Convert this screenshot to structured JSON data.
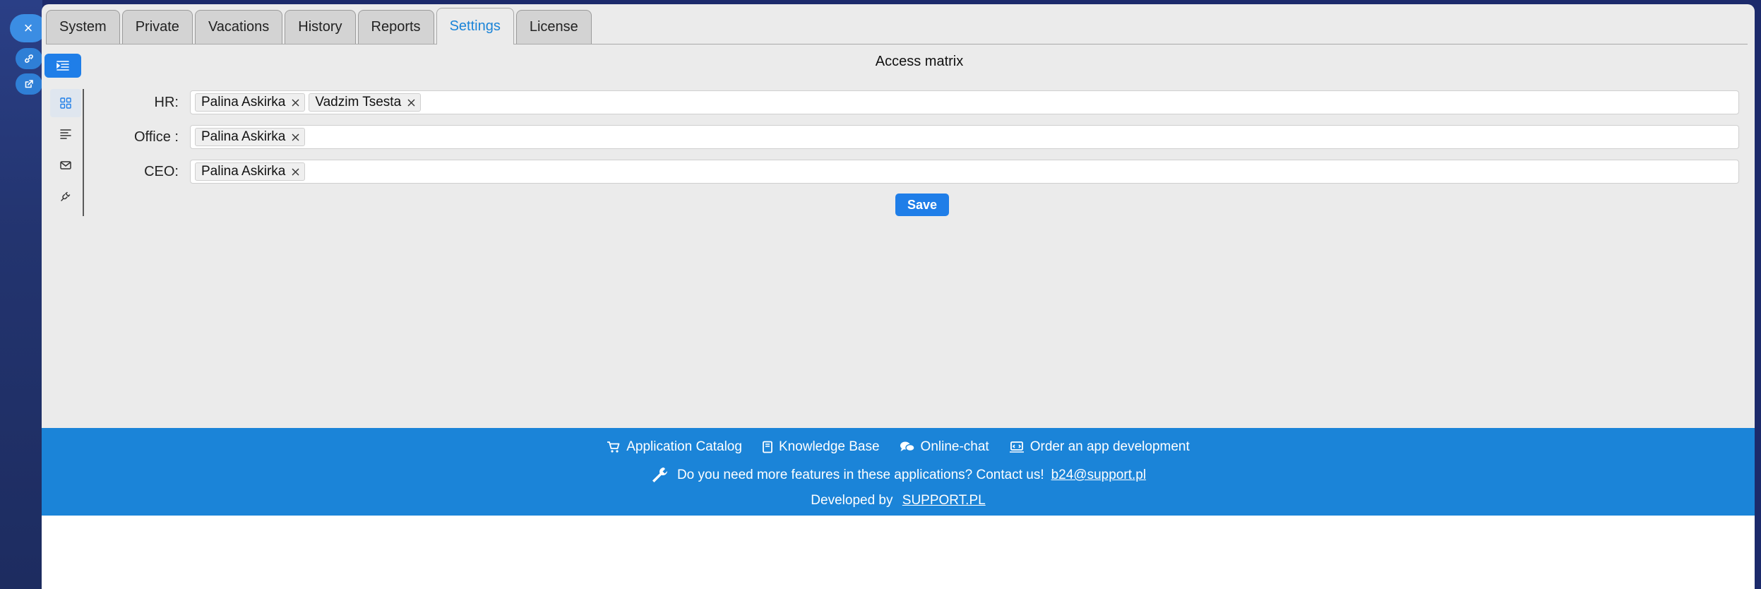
{
  "tabs": [
    {
      "label": "System"
    },
    {
      "label": "Private"
    },
    {
      "label": "Vacations"
    },
    {
      "label": "History"
    },
    {
      "label": "Reports"
    },
    {
      "label": "Settings"
    },
    {
      "label": "License"
    }
  ],
  "active_tab": "Settings",
  "section": {
    "title": "Access matrix"
  },
  "form": {
    "rows": [
      {
        "label": "HR:",
        "chips": [
          "Palina Askirka",
          "Vadzim Tsesta"
        ]
      },
      {
        "label": "Office :",
        "chips": [
          "Palina Askirka"
        ]
      },
      {
        "label": "CEO:",
        "chips": [
          "Palina Askirka"
        ]
      }
    ],
    "save_label": "Save"
  },
  "footer": {
    "links": [
      {
        "label": "Application Catalog",
        "icon": "cart-icon"
      },
      {
        "label": "Knowledge Base",
        "icon": "book-icon"
      },
      {
        "label": "Online-chat",
        "icon": "chat-icon"
      },
      {
        "label": "Order an app development",
        "icon": "monitor-icon"
      }
    ],
    "contact_text": "Do you need more features in these applications? Contact us!",
    "contact_email": "b24@support.pl",
    "developed_by": "Developed by",
    "brand": "SUPPORT.PL"
  },
  "colors": {
    "accent": "#1f7ee8",
    "footer_bg": "#1b84d8",
    "active_tab_text": "#1b84d8",
    "panel_bg": "#ebebeb"
  }
}
